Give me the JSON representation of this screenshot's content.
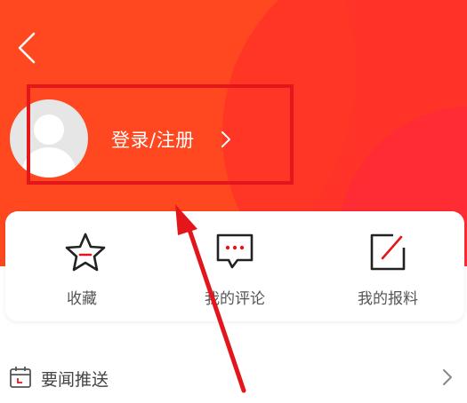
{
  "header": {
    "login_label": "登录/注册",
    "bg_color": "#ff3a22"
  },
  "quick_actions": [
    {
      "label": "收藏",
      "icon": "star-icon"
    },
    {
      "label": "我的评论",
      "icon": "comment-icon"
    },
    {
      "label": "我的报料",
      "icon": "edit-icon"
    }
  ],
  "list": {
    "push_news_label": "要闻推送"
  },
  "colors": {
    "accent_red": "#e3161b",
    "text_gray": "#555555"
  }
}
